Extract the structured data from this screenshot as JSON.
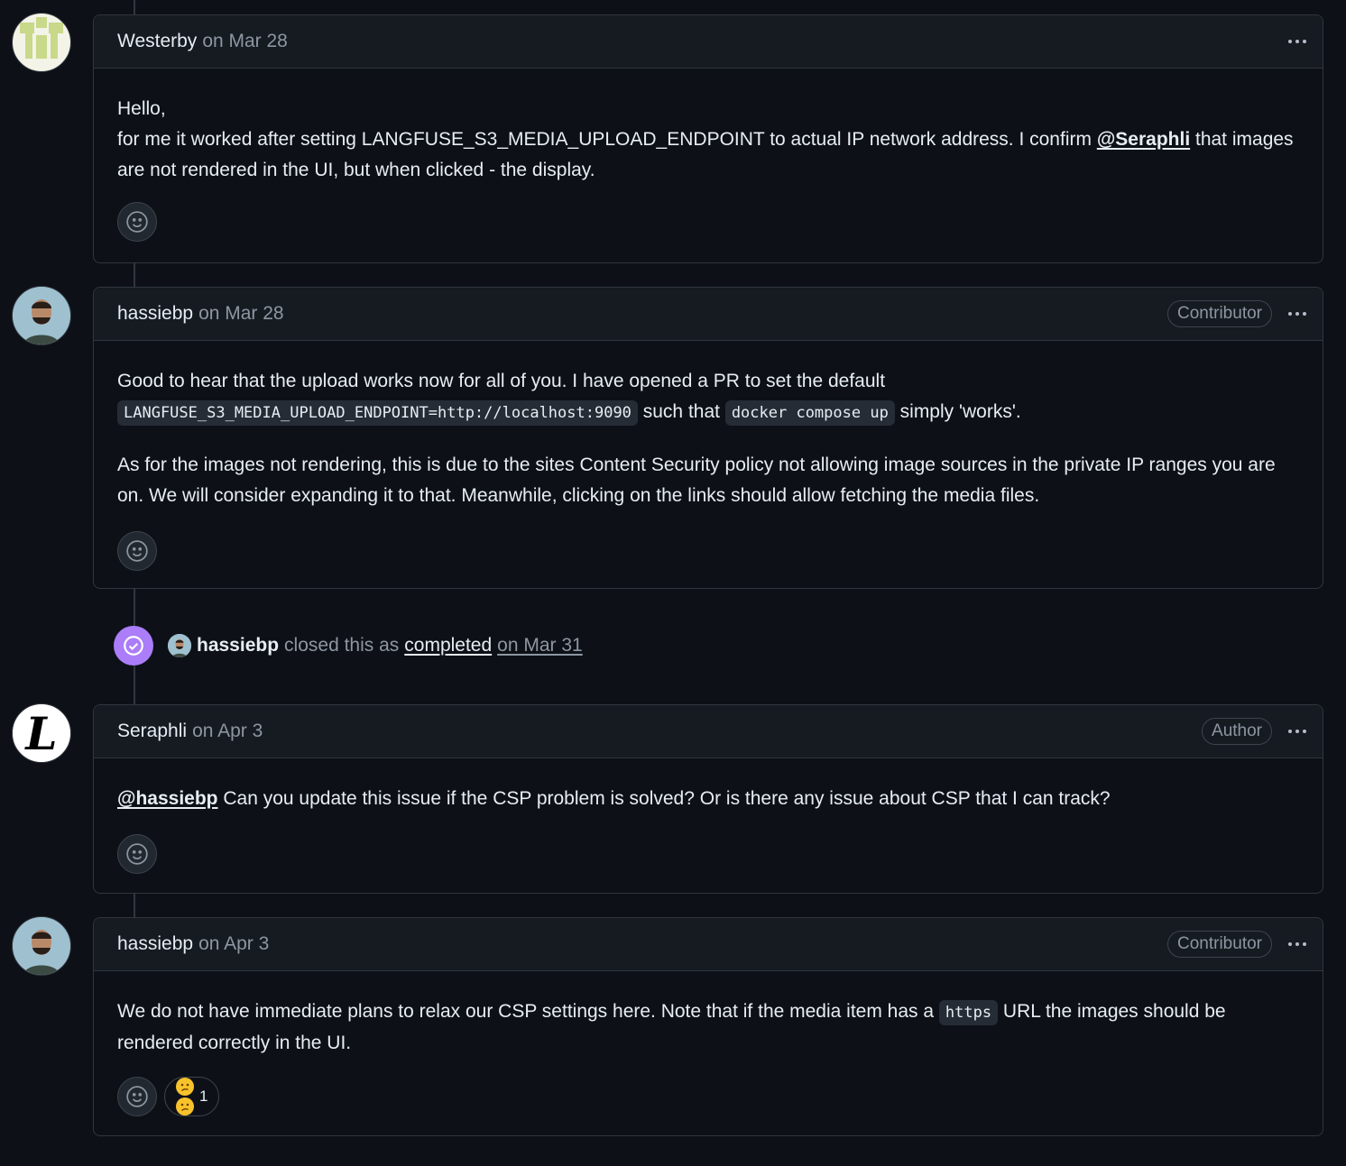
{
  "comments": [
    {
      "author": "Westerby",
      "date": "on Mar 28",
      "role": "",
      "body_line1": "Hello,",
      "body_line2_pre": "for me it worked after setting LANGFUSE_S3_MEDIA_UPLOAD_ENDPOINT to actual IP network address. I confirm ",
      "mention": "@Seraphli",
      "body_line2_post": " that images are not rendered in the UI, but when clicked - the display."
    },
    {
      "author": "hassiebp",
      "date": "on Mar 28",
      "role": "Contributor",
      "p1_pre": "Good to hear that the upload works now for all of you. I have opened a PR to set the default ",
      "p1_code1": "LANGFUSE_S3_MEDIA_UPLOAD_ENDPOINT=http://localhost:9090",
      "p1_mid": " such that ",
      "p1_code2": "docker compose up",
      "p1_post": " simply 'works'.",
      "p2": "As for the images not rendering, this is due to the sites Content Security policy not allowing image sources in the private IP ranges you are on. We will consider expanding it to that. Meanwhile, clicking on the links should allow fetching the media files."
    },
    {
      "author": "Seraphli",
      "date": "on Apr 3",
      "role": "Author",
      "mention": "@hassiebp",
      "body_post": " Can you update this issue if the CSP problem is solved? Or is there any issue about CSP that I can track?"
    },
    {
      "author": "hassiebp",
      "date": "on Apr 3",
      "role": "Contributor",
      "p1_pre": "We do not have immediate plans to relax our CSP settings here. Note that if the media item has a ",
      "p1_code": "https",
      "p1_post": " URL the images should be rendered correctly in the UI.",
      "reaction_count": "1"
    }
  ],
  "event": {
    "actor": "hassiebp",
    "text": "closed this as",
    "link": "completed",
    "date": "on Mar 31"
  },
  "colors": {
    "background": "#0d1117",
    "header": "#161b22",
    "border": "#30363d",
    "closed_purple": "#ab7df8"
  }
}
